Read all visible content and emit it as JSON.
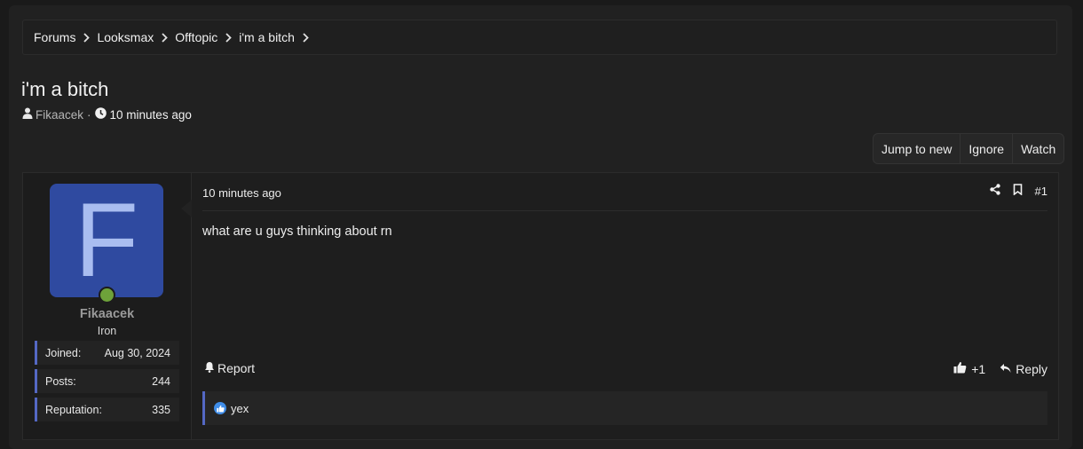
{
  "breadcrumb": [
    "Forums",
    "Looksmax",
    "Offtopic",
    "i'm a bitch"
  ],
  "thread": {
    "title": "i'm a bitch",
    "author": "Fikaacek",
    "time": "10 minutes ago"
  },
  "thread_buttons": [
    "Jump to new",
    "Ignore",
    "Watch"
  ],
  "post": {
    "user": {
      "avatar_letter": "F",
      "avatar_color": "#2f4aa0",
      "online_status_color": "#6ea23a",
      "username": "Fikaacek",
      "rank": "Iron",
      "stats": [
        {
          "label": "Joined:",
          "value": "Aug 30, 2024"
        },
        {
          "label": "Posts:",
          "value": "244"
        },
        {
          "label": "Reputation:",
          "value": "335"
        }
      ]
    },
    "time": "10 minutes ago",
    "number": "#1",
    "content": "what are u guys thinking about rn",
    "report_label": "Report",
    "like_label": "+1",
    "reply_label": "Reply",
    "reactions_text": "yex"
  },
  "colors": {
    "accent": "#5468c4",
    "background": "#1a1a1a",
    "panel": "#212121",
    "like_reaction": "#3f8de8"
  }
}
